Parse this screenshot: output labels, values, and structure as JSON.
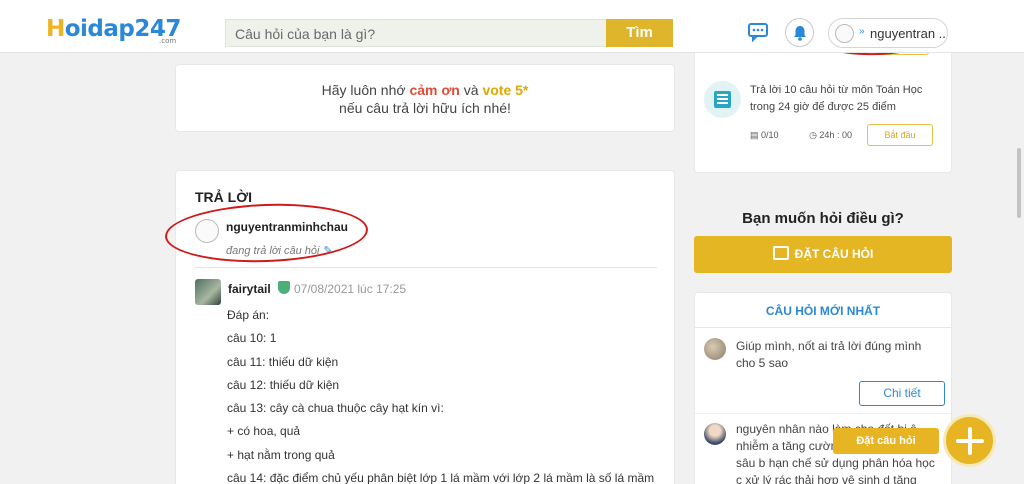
{
  "header": {
    "logo_prefix": "H",
    "logo_rest": "oidap247",
    "logo_sub": ".com",
    "search_placeholder": "Câu hỏi của bạn là gì?",
    "search_button": "Tìm",
    "user_name": "nguyentran ...",
    "user_dropdown": "»"
  },
  "note": {
    "line1_a": "Hãy luôn nhớ ",
    "line1_b": "cảm ơn",
    "line1_c": " và ",
    "line1_d": "vote 5*",
    "line2": "nếu câu trả lời hữu ích nhé!"
  },
  "answers": {
    "title": "TRẢ LỜI",
    "replier_name": "nguyentranminhchau",
    "replier_status": "đang trả lời câu hỏi",
    "answer": {
      "author": "fairytail",
      "time": "07/08/2021 lúc 17:25",
      "lines": [
        "Đáp án:",
        "câu 10: 1",
        "câu 11: thiếu dữ kiện",
        "câu 12: thiếu dữ kiện",
        "câu 13: cây cà chua thuộc cây hạt kín vì:",
        "+ có hoa, quả",
        "+ hạt nằm trong quả",
        "câu 14: đặc điểm chủ yếu phân biệt lớp 1 lá mầm với lớp 2 lá mầm là số lá mầm"
      ]
    }
  },
  "sidebar": {
    "task": {
      "text": "Trả lời 10 câu hỏi  từ môn Toán Học trong 24 giờ để được 25 điểm",
      "progress": "0/10",
      "duration": "24h : 00",
      "start": "Bắt đầu"
    },
    "ask_title": "Bạn muốn hỏi điều gì?",
    "ask_button": "ĐẶT CÂU HỎI",
    "newest": {
      "title": "CÂU HỎI MỚI NHẤT",
      "q1": "Giúp mình, nốt ai trả lời đúng mình cho 5 sao",
      "detail": "Chi tiết",
      "q2": "nguyên nhân nào làm cho đất bị ô nhiễm a tăng cường sử dụng thuốc b sâu b hạn chế sử dụng phân hóa học c xử lý rác thải hợp vệ sinh d tăng cường"
    }
  },
  "fab": {
    "label": "Đặt câu hỏi"
  },
  "colors": {
    "brand_blue": "#2b88d8",
    "brand_gold": "#e5b624",
    "annotation_red": "#d01a1a"
  }
}
